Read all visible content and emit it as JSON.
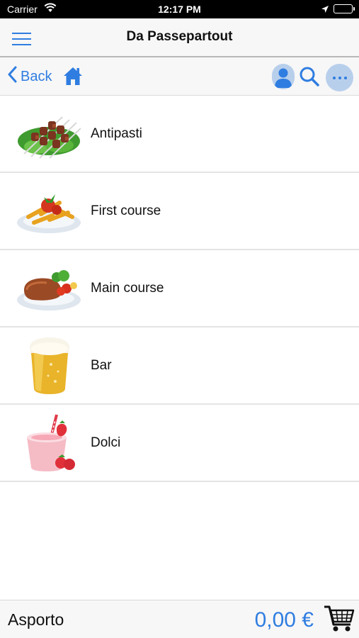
{
  "status_bar": {
    "carrier": "Carrier",
    "time": "12:17 PM",
    "icons": [
      "wifi-icon",
      "location-arrow-icon",
      "battery-icon"
    ]
  },
  "nav_bar": {
    "title": "Da Passepartout",
    "menu_icon": "hamburger-menu-icon"
  },
  "toolbar": {
    "back_label": "Back",
    "icons": [
      "chevron-left-icon",
      "home-icon",
      "user-icon",
      "search-icon",
      "more-icon"
    ]
  },
  "menu": {
    "categories": [
      {
        "label": "Antipasti",
        "icon": "skewers-icon"
      },
      {
        "label": "First course",
        "icon": "pasta-plate-icon"
      },
      {
        "label": "Main course",
        "icon": "steak-plate-icon"
      },
      {
        "label": "Bar",
        "icon": "beer-glass-icon"
      },
      {
        "label": "Dolci",
        "icon": "strawberry-dessert-icon"
      }
    ]
  },
  "footer": {
    "mode": "Asporto",
    "total": "0,00 €",
    "cart_icon": "shopping-cart-icon"
  },
  "colors": {
    "accent": "#2f7de1",
    "bar_background": "#f7f7f7",
    "status_bar": "#000000",
    "divider": "#e4e4e4"
  }
}
